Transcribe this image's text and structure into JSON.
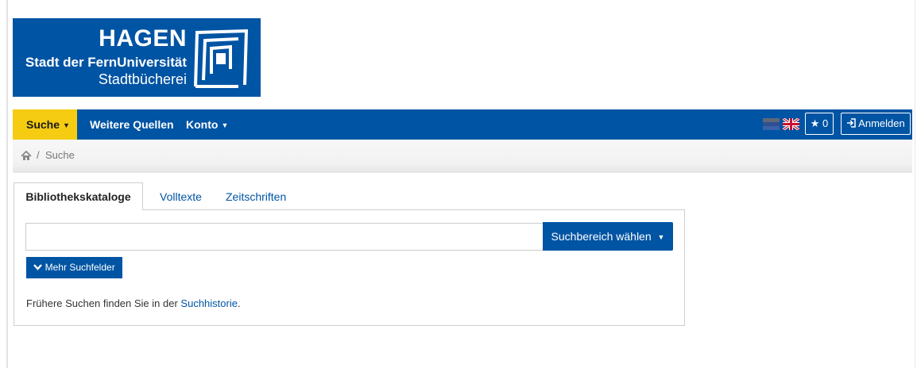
{
  "logo": {
    "title": "HAGEN",
    "subtitle": "Stadt der FernUniversität",
    "library": "Stadtbücherei",
    "brand_color": "#0054a4"
  },
  "navbar": {
    "items": [
      {
        "label": "Suche",
        "active": true,
        "dropdown": true
      },
      {
        "label": "Weitere Quellen",
        "dropdown": false
      },
      {
        "label": "Konto",
        "dropdown": true
      }
    ],
    "languages": [
      "de-flag-icon",
      "uk-flag-icon"
    ],
    "favorites_icon": "star-icon",
    "favorites_count": "0",
    "login_icon": "sign-in-icon",
    "login_label": "Anmelden",
    "highlight_color": "#f5cc11"
  },
  "breadcrumb": {
    "home_icon": "home-icon",
    "separator": "/",
    "current": "Suche"
  },
  "tabs": [
    {
      "label": "Bibliothekskataloge",
      "active": true
    },
    {
      "label": "Volltexte",
      "active": false
    },
    {
      "label": "Zeitschriften",
      "active": false
    }
  ],
  "search": {
    "value": "",
    "placeholder": "",
    "scope_label": "Suchbereich wählen",
    "more_fields_icon": "chevron-down-icon",
    "more_fields_label": "Mehr Suchfelder"
  },
  "history": {
    "text": "Frühere Suchen finden Sie in der",
    "link": "Suchhistorie",
    "suffix": "."
  }
}
